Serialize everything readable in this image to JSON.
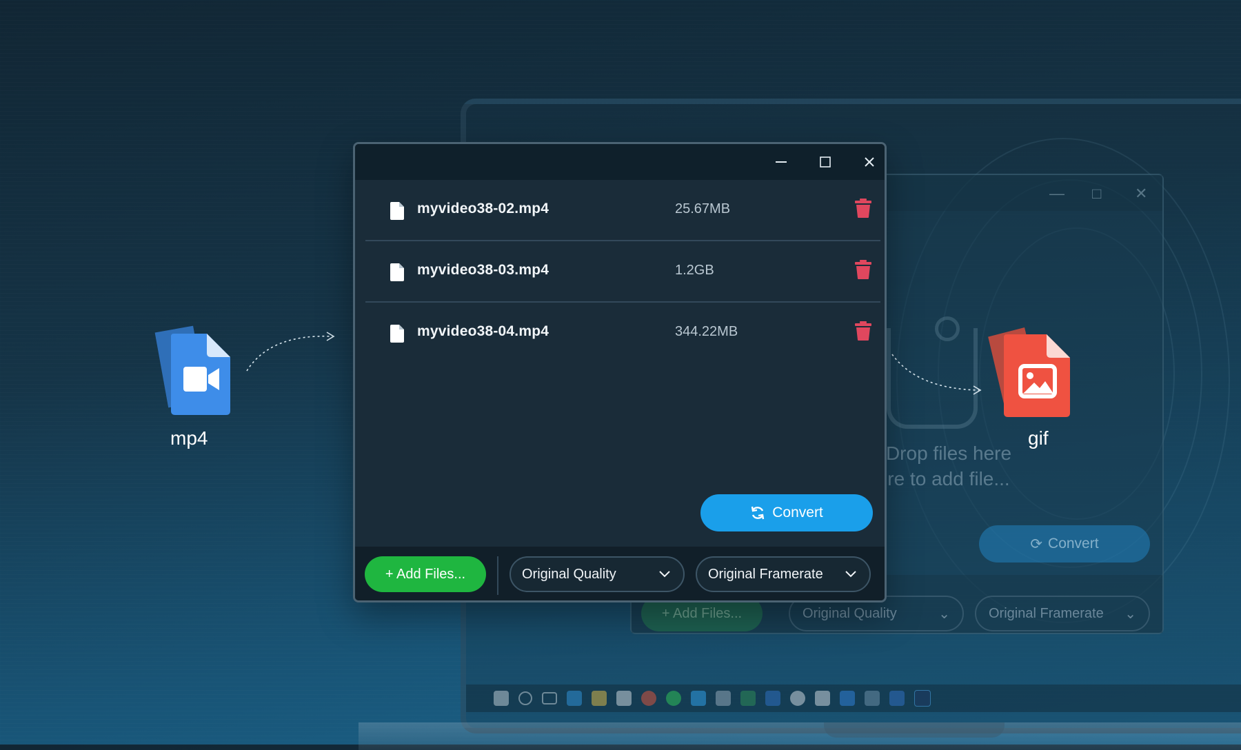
{
  "left_format": {
    "label": "mp4",
    "icon": "video-file-icon",
    "color": "#3e8de9"
  },
  "right_format": {
    "label": "gif",
    "icon": "image-file-icon",
    "color": "#ef5241"
  },
  "window": {
    "controls": {
      "minimize": "—",
      "maximize": "□",
      "close": "✕"
    },
    "files": [
      {
        "name": "myvideo38-02.mp4",
        "size": "25.67MB"
      },
      {
        "name": "myvideo38-03.mp4",
        "size": "1.2GB"
      },
      {
        "name": "myvideo38-04.mp4",
        "size": "344.22MB"
      }
    ],
    "convert_label": "Convert",
    "add_files_label": "+ Add Files...",
    "quality_value": "Original Quality",
    "framerate_value": "Original Framerate"
  },
  "background_window": {
    "drop_text_line1": "Drop files here",
    "drop_text_line2": "re to add file...",
    "convert_label": "Convert",
    "add_files_label": "+ Add Files...",
    "quality_value": "Original Quality",
    "framerate_value": "Original Framerate"
  },
  "colors": {
    "accent_blue": "#1a9fea",
    "accent_green": "#1fb640",
    "delete_red": "#e0475e"
  }
}
